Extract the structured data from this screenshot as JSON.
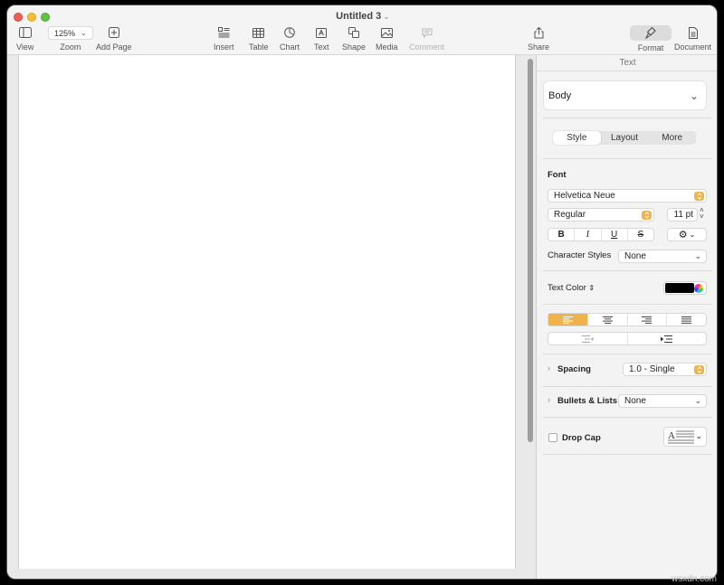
{
  "window": {
    "title": "Untitled 3"
  },
  "toolbar": {
    "view_label": "View",
    "zoom_value": "125%",
    "zoom_label": "Zoom",
    "add_page_label": "Add Page",
    "insert_label": "Insert",
    "table_label": "Table",
    "chart_label": "Chart",
    "text_label": "Text",
    "shape_label": "Shape",
    "media_label": "Media",
    "comment_label": "Comment",
    "share_label": "Share",
    "format_label": "Format",
    "document_label": "Document"
  },
  "inspector": {
    "header": "Text",
    "paragraph_style": "Body",
    "tabs": [
      "Style",
      "Layout",
      "More"
    ],
    "font_section": "Font",
    "font_family": "Helvetica Neue",
    "font_weight": "Regular",
    "font_size": "11 pt",
    "style_buttons": [
      "B",
      "I",
      "U",
      "S"
    ],
    "character_styles_label": "Character Styles",
    "character_styles_value": "None",
    "text_color_label": "Text Color",
    "text_color": "#000000",
    "accent_color": "#f0b24a",
    "spacing_label": "Spacing",
    "spacing_value": "1.0 - Single",
    "bullets_label": "Bullets & Lists",
    "bullets_value": "None",
    "drop_cap_label": "Drop Cap"
  },
  "watermark": "wsxdn.com"
}
